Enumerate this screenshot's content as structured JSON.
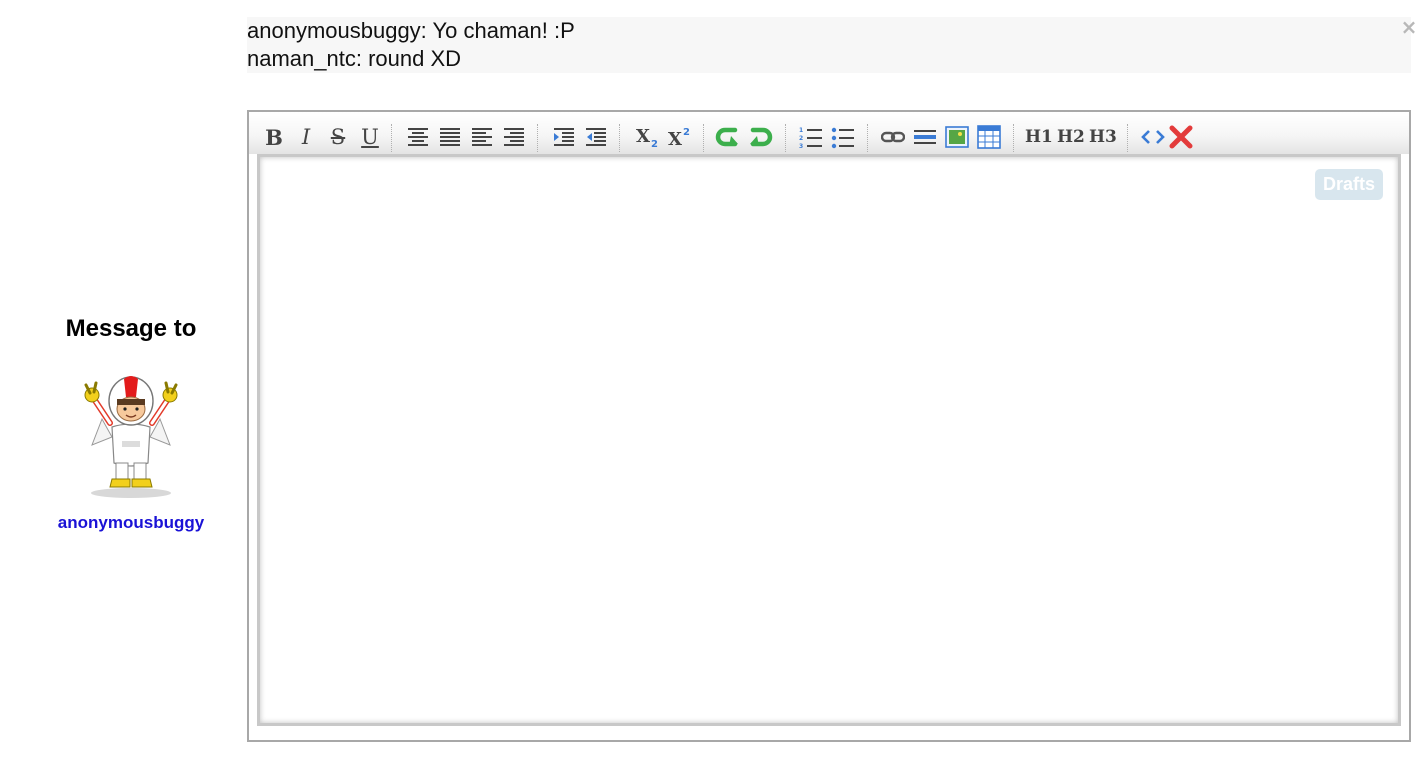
{
  "chat": {
    "messages": [
      "anonymousbuggy: Yo chaman! :P",
      "naman_ntc: round XD"
    ],
    "close_icon": "close-icon"
  },
  "recipient": {
    "heading": "Message to",
    "username": "anonymousbuggy",
    "avatar_icon": "cartoon-avatar",
    "username_color": "#1a12d6"
  },
  "editor": {
    "drafts_label": "Drafts",
    "toolbar": {
      "bold": "B",
      "italic": "I",
      "strike": "S",
      "underline": "U",
      "heading1": "H1",
      "heading2": "H2",
      "heading3": "H3",
      "icons": [
        "bold-icon",
        "italic-icon",
        "strikethrough-icon",
        "underline-icon",
        "align-center-icon",
        "justify-icon",
        "align-left-icon",
        "align-right-icon",
        "indent-icon",
        "outdent-icon",
        "subscript-icon",
        "superscript-icon",
        "undo-icon",
        "redo-icon",
        "ordered-list-icon",
        "unordered-list-icon",
        "link-icon",
        "horizontal-rule-icon",
        "image-icon",
        "table-icon",
        "h1-icon",
        "h2-icon",
        "h3-icon",
        "source-code-icon",
        "remove-format-icon"
      ]
    }
  }
}
